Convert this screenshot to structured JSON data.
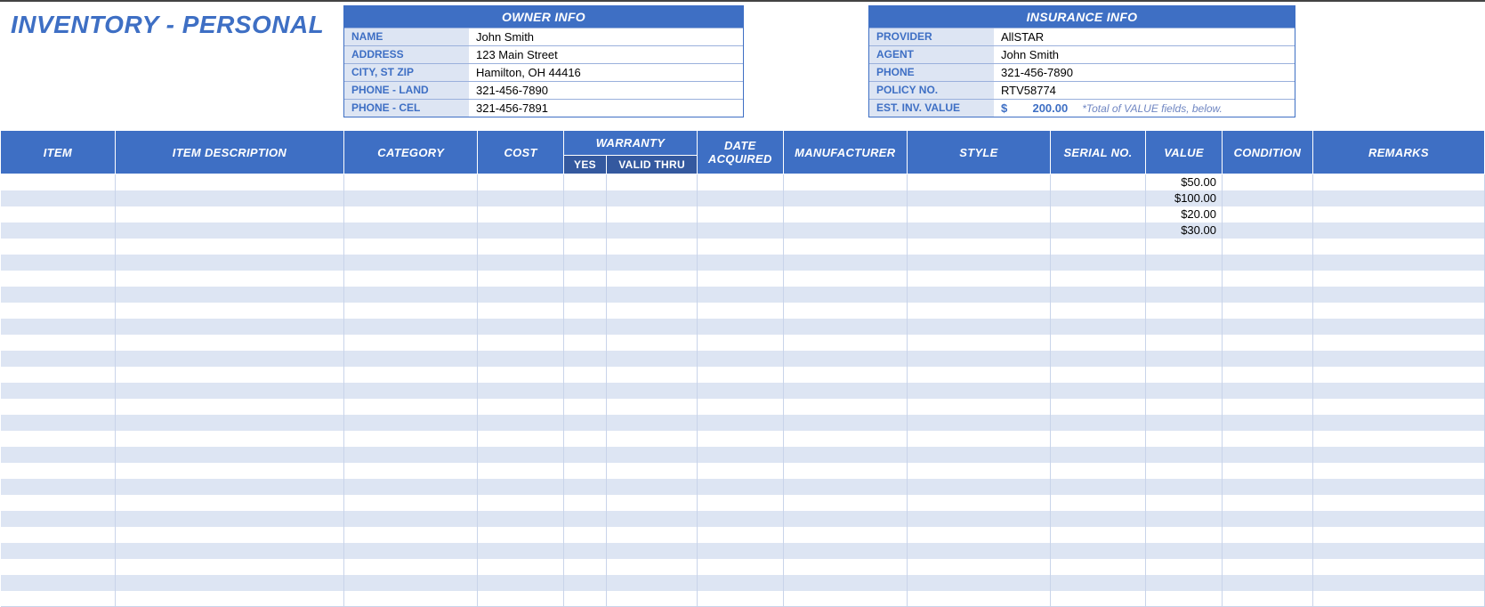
{
  "title": "INVENTORY - PERSONAL",
  "owner_info": {
    "header": "OWNER INFO",
    "labels": {
      "name": "NAME",
      "address": "ADDRESS",
      "city": "CITY, ST  ZIP",
      "phone_land": "PHONE - LAND",
      "phone_cel": "PHONE - CEL"
    },
    "values": {
      "name": "John Smith",
      "address": "123 Main Street",
      "city": "Hamilton, OH  44416",
      "phone_land": "321-456-7890",
      "phone_cel": "321-456-7891"
    }
  },
  "insurance_info": {
    "header": "INSURANCE INFO",
    "labels": {
      "provider": "PROVIDER",
      "agent": "AGENT",
      "phone": "PHONE",
      "policy": "POLICY NO.",
      "est": "EST. INV. VALUE"
    },
    "values": {
      "provider": "AllSTAR",
      "agent": "John Smith",
      "phone": "321-456-7890",
      "policy": "RTV58774",
      "est_currency": "$",
      "est_amount": "200.00",
      "est_note": "*Total of VALUE fields, below."
    }
  },
  "columns": {
    "item": "ITEM",
    "desc": "ITEM DESCRIPTION",
    "category": "CATEGORY",
    "cost": "COST",
    "warranty": "WARRANTY",
    "warranty_yes": "YES",
    "warranty_valid": "VALID THRU",
    "date_acquired": "DATE ACQUIRED",
    "manufacturer": "MANUFACTURER",
    "style": "STYLE",
    "serial": "SERIAL NO.",
    "value": "VALUE",
    "condition": "CONDITION",
    "remarks": "REMARKS"
  },
  "rows": [
    {
      "value": "$50.00"
    },
    {
      "value": "$100.00"
    },
    {
      "value": "$20.00"
    },
    {
      "value": "$30.00"
    },
    {},
    {},
    {},
    {},
    {},
    {},
    {},
    {},
    {},
    {},
    {},
    {},
    {},
    {},
    {},
    {},
    {},
    {},
    {},
    {},
    {},
    {},
    {}
  ]
}
